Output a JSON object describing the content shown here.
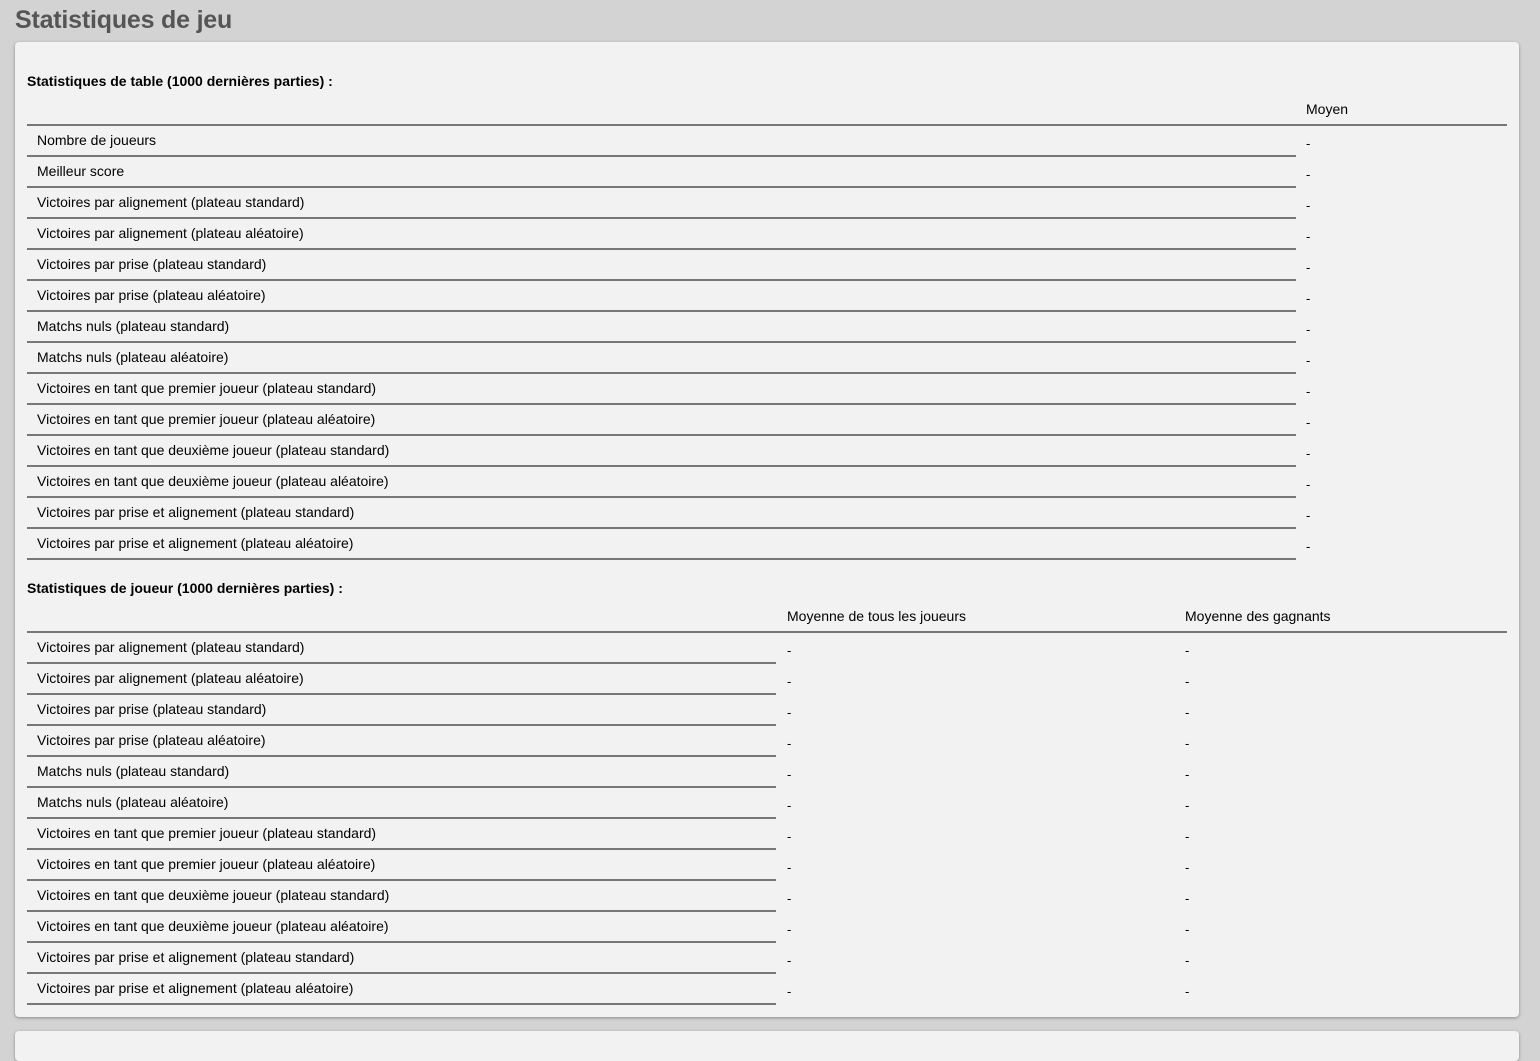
{
  "page_title": "Statistiques de jeu",
  "table_stats": {
    "title": "Statistiques de table (1000 dernières parties) :",
    "column_header": "Moyen",
    "rows": [
      {
        "label": "Nombre de joueurs",
        "value": "-"
      },
      {
        "label": "Meilleur score",
        "value": "-"
      },
      {
        "label": "Victoires par alignement (plateau standard)",
        "value": "-"
      },
      {
        "label": "Victoires par alignement (plateau aléatoire)",
        "value": "-"
      },
      {
        "label": "Victoires par prise (plateau standard)",
        "value": "-"
      },
      {
        "label": "Victoires par prise (plateau aléatoire)",
        "value": "-"
      },
      {
        "label": "Matchs nuls (plateau standard)",
        "value": "-"
      },
      {
        "label": "Matchs nuls (plateau aléatoire)",
        "value": "-"
      },
      {
        "label": "Victoires en tant que premier joueur (plateau standard)",
        "value": "-"
      },
      {
        "label": "Victoires en tant que premier joueur (plateau aléatoire)",
        "value": "-"
      },
      {
        "label": "Victoires en tant que deuxième joueur (plateau standard)",
        "value": "-"
      },
      {
        "label": "Victoires en tant que deuxième joueur (plateau aléatoire)",
        "value": "-"
      },
      {
        "label": "Victoires par prise et alignement (plateau standard)",
        "value": "-"
      },
      {
        "label": "Victoires par prise et alignement (plateau aléatoire)",
        "value": "-"
      }
    ]
  },
  "player_stats": {
    "title": "Statistiques de joueur (1000 dernières parties) :",
    "column_headers": [
      "Moyenne de tous les joueurs",
      "Moyenne des gagnants"
    ],
    "rows": [
      {
        "label": "Victoires par alignement (plateau standard)",
        "all": "-",
        "winners": "-"
      },
      {
        "label": "Victoires par alignement (plateau aléatoire)",
        "all": "-",
        "winners": "-"
      },
      {
        "label": "Victoires par prise (plateau standard)",
        "all": "-",
        "winners": "-"
      },
      {
        "label": "Victoires par prise (plateau aléatoire)",
        "all": "-",
        "winners": "-"
      },
      {
        "label": "Matchs nuls (plateau standard)",
        "all": "-",
        "winners": "-"
      },
      {
        "label": "Matchs nuls (plateau aléatoire)",
        "all": "-",
        "winners": "-"
      },
      {
        "label": "Victoires en tant que premier joueur (plateau standard)",
        "all": "-",
        "winners": "-"
      },
      {
        "label": "Victoires en tant que premier joueur (plateau aléatoire)",
        "all": "-",
        "winners": "-"
      },
      {
        "label": "Victoires en tant que deuxième joueur (plateau standard)",
        "all": "-",
        "winners": "-"
      },
      {
        "label": "Victoires en tant que deuxième joueur (plateau aléatoire)",
        "all": "-",
        "winners": "-"
      },
      {
        "label": "Victoires par prise et alignement (plateau standard)",
        "all": "-",
        "winners": "-"
      },
      {
        "label": "Victoires par prise et alignement (plateau aléatoire)",
        "all": "-",
        "winners": "-"
      }
    ]
  }
}
